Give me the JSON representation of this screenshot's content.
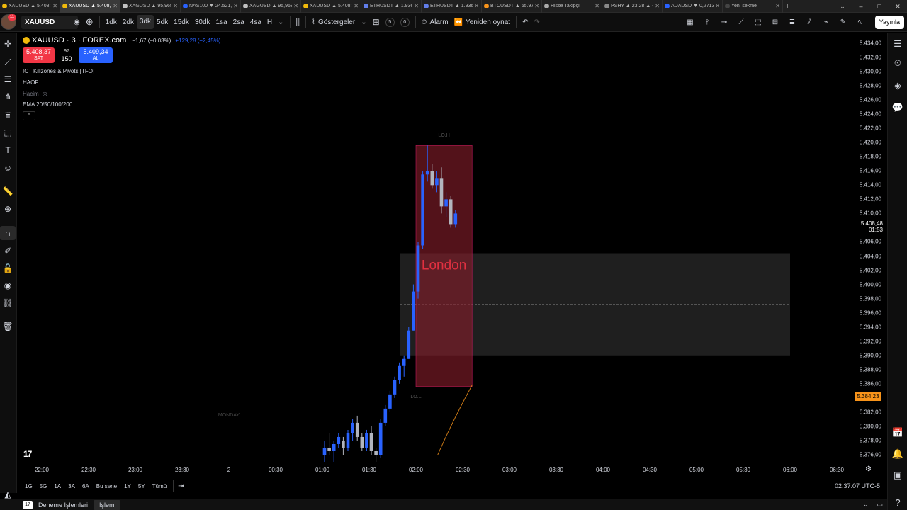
{
  "tabs": [
    {
      "label": "XAUUSD ▲ 5.408,37",
      "color": "#f0b90b",
      "active": false
    },
    {
      "label": "XAUUSD ▲ 5.408,37",
      "color": "#f0b90b",
      "active": true
    },
    {
      "label": "XAGUSD ▲ 95,968",
      "color": "#c0c0c0",
      "active": false
    },
    {
      "label": "NAS100 ▼ 24.521,3",
      "color": "#2962ff",
      "active": false
    },
    {
      "label": "XAGUSD ▲ 95,968",
      "color": "#c0c0c0",
      "active": false
    },
    {
      "label": "XAUUSD ▲ 5.408,37",
      "color": "#f0b90b",
      "active": false
    },
    {
      "label": "ETHUSDT ▲ 1.936",
      "color": "#627eea",
      "active": false
    },
    {
      "label": "ETHUSDT ▲ 1.936",
      "color": "#627eea",
      "active": false
    },
    {
      "label": "BTCUSDT ▲ 65.978",
      "color": "#f7931a",
      "active": false
    },
    {
      "label": "Hisse Takipçi",
      "color": "#aaaaaa",
      "active": false
    },
    {
      "label": "PSHY ▲ 23,28 ▲ -2,39",
      "color": "#888888",
      "active": false
    },
    {
      "label": "ADAUSD ▼ 0,27136",
      "color": "#2962ff",
      "active": false
    },
    {
      "label": "Yeni sekme",
      "color": "#444444",
      "active": false
    }
  ],
  "toolbar": {
    "avatar_badge": "11",
    "symbol": "XAUUSD",
    "intervals": [
      "1dk",
      "2dk",
      "3dk",
      "5dk",
      "15dk",
      "30dk",
      "1sa",
      "2sa",
      "4sa",
      "H"
    ],
    "selected_interval": "3dk",
    "indicators_label": "Göstergeler",
    "layout_count_a": "5",
    "layout_count_b": "0",
    "alarm_label": "Alarm",
    "replay_label": "Yeniden oynat",
    "publish_label": "Yayınla"
  },
  "legend": {
    "title": "XAUUSD · 3 · FOREX.com",
    "change": "−1,67 (−0,03%)",
    "change2": "+129,28 (+2,45%)",
    "sell_price": "5.408,37",
    "sell_label": "SAT",
    "buy_price": "5.409,34",
    "buy_label": "AL",
    "spread_top": "97",
    "spread": "150",
    "indicators": [
      "ICT Killzones & Pivots [TFO]",
      "HAOF",
      "Hacim",
      "EMA 20/50/100/200"
    ]
  },
  "chart_data": {
    "type": "candlestick",
    "y_ticks": [
      "5.434,00",
      "5.432,00",
      "5.430,00",
      "5.428,00",
      "5.426,00",
      "5.424,00",
      "5.422,00",
      "5.420,00",
      "5.418,00",
      "5.416,00",
      "5.414,00",
      "5.412,00",
      "5.410,00",
      "5.408,00",
      "5.406,00",
      "5.404,00",
      "5.402,00",
      "5.400,00",
      "5.398,00",
      "5.396,00",
      "5.394,00",
      "5.392,00",
      "5.390,00",
      "5.388,00",
      "5.386,00",
      "5.384,00",
      "5.382,00",
      "5.380,00",
      "5.378,00",
      "5.376,00"
    ],
    "x_ticks": [
      "22:00",
      "22:30",
      "23:00",
      "23:30",
      "2",
      "00:30",
      "01:00",
      "01:30",
      "02:00",
      "02:30",
      "03:00",
      "03:30",
      "04:00",
      "04:30",
      "05:00",
      "05:30",
      "06:00",
      "06:30"
    ],
    "current_price": "5.408,48",
    "countdown": "01:53",
    "ema_tag": "5.384,23",
    "killzone_label": "London",
    "lo_h_label": "LO.H",
    "lo_l_label": "LO.L",
    "monday_label": "MONDAY",
    "killzone": {
      "from_time": "02:00",
      "to_time": "02:36",
      "high": 5419.6,
      "low": 5385.6
    },
    "range_box": {
      "from_time": "01:50",
      "to_time": "06:00",
      "high": 5404.4,
      "low": 5390.0,
      "mid": 5397.2
    },
    "candles": [
      [
        5376,
        5378,
        5375,
        5377
      ],
      [
        5377,
        5379,
        5376,
        5376.5
      ],
      [
        5376.5,
        5378,
        5375,
        5377.5
      ],
      [
        5377.5,
        5379,
        5377,
        5378.5
      ],
      [
        5378,
        5378.5,
        5376,
        5377
      ],
      [
        5377,
        5379.5,
        5376.5,
        5379
      ],
      [
        5379,
        5381,
        5378,
        5380.5
      ],
      [
        5380.5,
        5381.5,
        5378,
        5378.5
      ],
      [
        5378.5,
        5379,
        5376.5,
        5377
      ],
      [
        5377,
        5379.5,
        5376.5,
        5379
      ],
      [
        5379,
        5380,
        5376,
        5376.5
      ],
      [
        5376.5,
        5377,
        5375,
        5376
      ],
      [
        5376,
        5381,
        5375.5,
        5380.5
      ],
      [
        5380.5,
        5383,
        5380,
        5382.5
      ],
      [
        5382.5,
        5385,
        5382,
        5384.5
      ],
      [
        5384.5,
        5387,
        5384,
        5386.5
      ],
      [
        5386.5,
        5389,
        5386,
        5388.5
      ],
      [
        5388.5,
        5390,
        5387,
        5389.5
      ],
      [
        5389.5,
        5394,
        5389.5,
        5393.5
      ],
      [
        5393.5,
        5400,
        5393.5,
        5399
      ],
      [
        5399,
        5406,
        5398,
        5405.5
      ],
      [
        5405.5,
        5416,
        5405,
        5415.5
      ],
      [
        5415.5,
        5419.6,
        5414.5,
        5416
      ],
      [
        5416,
        5417,
        5413.5,
        5414
      ],
      [
        5414,
        5416,
        5413,
        5415
      ],
      [
        5415,
        5416.5,
        5410,
        5411
      ],
      [
        5411,
        5413,
        5409.5,
        5412
      ],
      [
        5412,
        5412.5,
        5408,
        5408.5
      ],
      [
        5408.5,
        5410.5,
        5408,
        5410
      ]
    ]
  },
  "bottombar": {
    "ranges": [
      "1G",
      "5G",
      "1A",
      "3A",
      "6A",
      "Bu sene",
      "1Y",
      "5Y",
      "Tümü"
    ],
    "clock": "02:37:07 UTC-5"
  },
  "panel": {
    "tabs": [
      "Deneme İşlemleri",
      "İşlem"
    ],
    "selected": "İşlem"
  },
  "colors": {
    "bull": "#2962ff",
    "bear": "#b2b5be",
    "killzone": "#8b1e2b",
    "range": "#2a2a2a",
    "ema": "#f7931a"
  }
}
